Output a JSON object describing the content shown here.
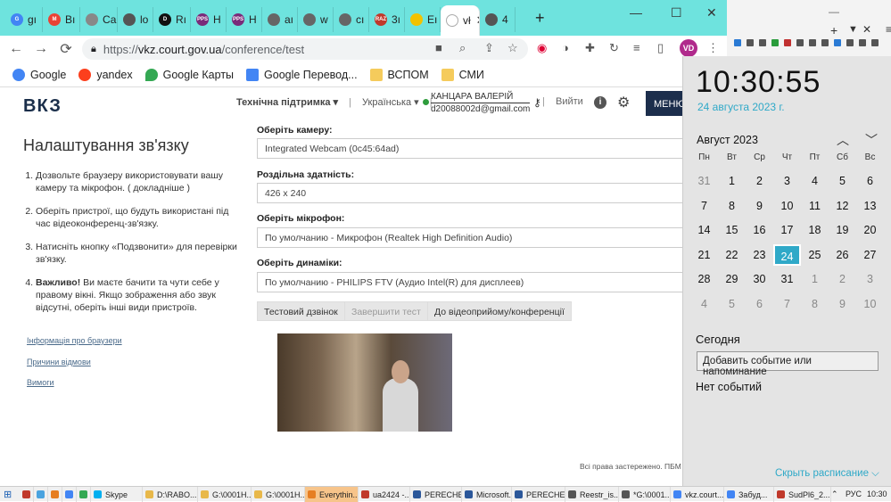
{
  "tabs": [
    {
      "label": "gı",
      "color": "#4285f4",
      "glyph": "G"
    },
    {
      "label": "Вı",
      "color": "#ea4335",
      "glyph": "M"
    },
    {
      "label": "Сайт",
      "color": "#888888",
      "glyph": ""
    },
    {
      "label": "lo",
      "color": "#555555",
      "glyph": ""
    },
    {
      "label": "Rı",
      "color": "#111111",
      "glyph": "D"
    },
    {
      "label": "Н",
      "color": "#7a2b7a",
      "glyph": "PPS"
    },
    {
      "label": "Н",
      "color": "#7a2b7a",
      "glyph": "PPS"
    },
    {
      "label": "aı",
      "color": "#666666",
      "glyph": ""
    },
    {
      "label": "w",
      "color": "#666666",
      "glyph": ""
    },
    {
      "label": "cı",
      "color": "#666666",
      "glyph": ""
    },
    {
      "label": "3ı",
      "color": "#c0392b",
      "glyph": "RAZ"
    },
    {
      "label": "Еı",
      "color": "#f2c200",
      "glyph": ""
    },
    {
      "label": "vł",
      "color": "#ffffff",
      "glyph": ""
    },
    {
      "label": "4",
      "color": "#555555",
      "glyph": ""
    }
  ],
  "address": {
    "scheme": "https://",
    "host": "vkz.court.gov.ua",
    "path": "/conference/test"
  },
  "profile_initials": "VD",
  "bookmarks": [
    "Google",
    "yandex",
    "Google Карты",
    "Google Перевод...",
    "ВСПОМ",
    "СМИ"
  ],
  "site": {
    "logo": "ВКЗ",
    "support": "Технічна підтримка ▾",
    "sep1": "|",
    "lang": "Українська ▾",
    "sep2": "|",
    "user_name": "КАНЦАРА ВАЛЕРІЙ",
    "user_email": "d20088002d@gmail.com",
    "logout": "Вийти",
    "menu": "МЕНЮ",
    "title": "Налаштування зв'язку",
    "steps": [
      "Дозвольте браузеру використовувати вашу камеру та мікрофон. ( докладніше )",
      "Оберіть пристрої, що будуть використані під час відеоконференц-зв'язку.",
      "Натисніть кнопку «Подзвонити» для перевірки зв'язку.",
      "Ви маєте бачити та чути себе у правому вікні. Якщо зображення або звук відсутні, оберіть інші види пристроїв."
    ],
    "step4_bold": "Важливо!",
    "links": [
      "Інформація про браузери",
      "Причини відмови",
      "Вимоги"
    ],
    "camera_label": "Оберіть камеру:",
    "camera_value": "Integrated Webcam (0c45:64ad)",
    "res_label": "Роздільна здатність:",
    "res_value": "426 x 240",
    "mic_label": "Оберіть мікрофон:",
    "mic_value": "По умолчанию - Микрофон (Realtek High Definition Audio)",
    "spk_label": "Оберіть динаміки:",
    "spk_value": "По умолчанию - PHILIPS FTV (Аудио Intel(R) для дисплеев)",
    "btn_test": "Тестовий дзвінок",
    "btn_end": "Завершити тест",
    "btn_go": "До відеоприйому/конференції",
    "footer": "Всі права застережено. ПБМ",
    "footer_tail": "v"
  },
  "calendar": {
    "time": "10:30:55",
    "date": "24 августа 2023 г.",
    "month": "Август 2023",
    "weekdays": [
      "Пн",
      "Вт",
      "Ср",
      "Чт",
      "Пт",
      "Сб",
      "Вс"
    ],
    "days": [
      [
        "31",
        "1",
        "2",
        "3",
        "4",
        "5",
        "6"
      ],
      [
        "7",
        "8",
        "9",
        "10",
        "11",
        "12",
        "13"
      ],
      [
        "14",
        "15",
        "16",
        "17",
        "18",
        "19",
        "20"
      ],
      [
        "21",
        "22",
        "23",
        "24",
        "25",
        "26",
        "27"
      ],
      [
        "28",
        "29",
        "30",
        "31",
        "1",
        "2",
        "3"
      ],
      [
        "4",
        "5",
        "6",
        "7",
        "8",
        "9",
        "10"
      ]
    ],
    "today": "24",
    "today_label": "Сегодня",
    "add_event": "Добавить событие или напоминание",
    "no_events": "Нет событий",
    "hide": "Скрыть расписание ⌵"
  },
  "taskbar": {
    "items": [
      {
        "label": "",
        "color": "#c0392b"
      },
      {
        "label": "",
        "color": "#4aa3df"
      },
      {
        "label": "",
        "color": "#e67e22"
      },
      {
        "label": "",
        "color": "#4285f4"
      },
      {
        "label": "",
        "color": "#34a853"
      },
      {
        "label": "Skype",
        "color": "#00aff0"
      },
      {
        "label": "D:\\RABO...",
        "color": "#e8b84a"
      },
      {
        "label": "G:\\0001H...",
        "color": "#e8b84a"
      },
      {
        "label": "G:\\0001H...",
        "color": "#e8b84a"
      },
      {
        "label": "Everythin...",
        "color": "#e67e22"
      },
      {
        "label": "ua2424 -...",
        "color": "#c0392b"
      },
      {
        "label": "PERECHE...",
        "color": "#2b579a"
      },
      {
        "label": "Microsoft...",
        "color": "#2b579a"
      },
      {
        "label": "PERECHE...",
        "color": "#2b579a"
      },
      {
        "label": "Reestr_is...",
        "color": "#555555"
      },
      {
        "label": "*G:\\0001...",
        "color": "#555555"
      },
      {
        "label": "vkz.court....",
        "color": "#4285f4"
      },
      {
        "label": "Забуд...",
        "color": "#4285f4"
      },
      {
        "label": "SudPl6_2...",
        "color": "#c0392b"
      }
    ],
    "lang": "РУС",
    "time": "10:30"
  }
}
